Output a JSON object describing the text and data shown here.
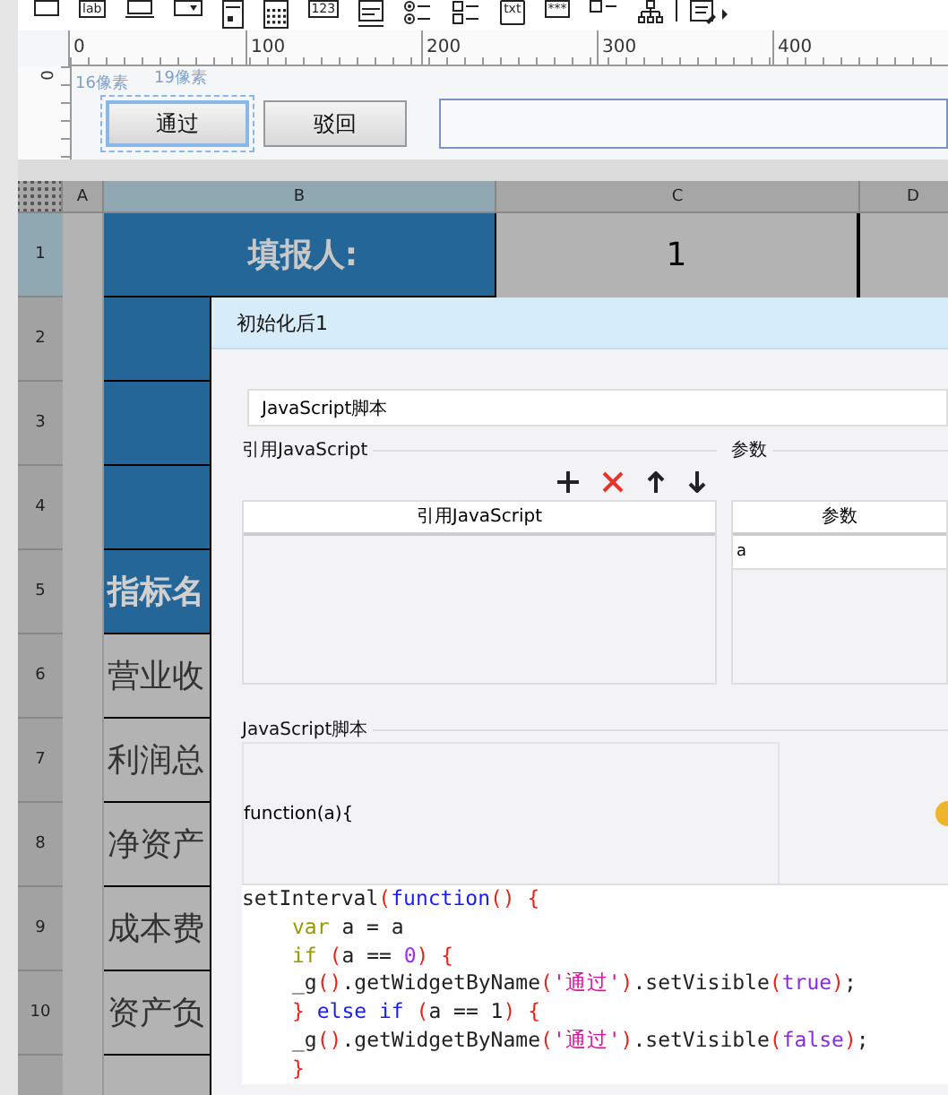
{
  "toolbar": [
    {
      "kind": "box"
    },
    {
      "kind": "label",
      "text": "lab"
    },
    {
      "kind": "input"
    },
    {
      "kind": "combo"
    },
    {
      "kind": "form"
    },
    {
      "kind": "calendar"
    },
    {
      "kind": "number",
      "text": "123"
    },
    {
      "kind": "textarea"
    },
    {
      "kind": "radio"
    },
    {
      "kind": "checkbox"
    },
    {
      "kind": "text",
      "text": "txt"
    },
    {
      "kind": "password",
      "text": "***"
    },
    {
      "kind": "check"
    },
    {
      "kind": "tree"
    },
    {
      "kind": "list"
    }
  ],
  "ruler": {
    "ticks": [
      "0",
      "100",
      "200",
      "300",
      "400"
    ],
    "vertical_tick": "0"
  },
  "canvas": {
    "top_hint": "19像素",
    "left_hint": "16像素",
    "buttons": [
      {
        "label": "通过",
        "selected": true
      },
      {
        "label": "驳回",
        "selected": false
      }
    ]
  },
  "sheet": {
    "columns": [
      {
        "label": "A",
        "selected": false
      },
      {
        "label": "B",
        "selected": true
      },
      {
        "label": "C",
        "selected": false
      },
      {
        "label": "D",
        "selected": false
      }
    ],
    "rows": [
      {
        "number": "1",
        "selected": true,
        "b": "填报人:",
        "c": "1",
        "kind": "header"
      },
      {
        "number": "2",
        "selected": false,
        "kind": "blue"
      },
      {
        "number": "3",
        "selected": false,
        "kind": "blue"
      },
      {
        "number": "4",
        "selected": false,
        "kind": "blue"
      },
      {
        "number": "5",
        "selected": false,
        "b": "指标名",
        "kind": "title"
      },
      {
        "number": "6",
        "selected": false,
        "b": "营业收",
        "kind": "plain"
      },
      {
        "number": "7",
        "selected": false,
        "b": "利润总",
        "kind": "plain"
      },
      {
        "number": "8",
        "selected": false,
        "b": "净资产",
        "kind": "plain"
      },
      {
        "number": "9",
        "selected": false,
        "b": "成本费",
        "kind": "plain"
      },
      {
        "number": "10",
        "selected": false,
        "b": "资产负",
        "kind": "plain"
      },
      {
        "selected": false,
        "kind": "plain"
      }
    ]
  },
  "dialog": {
    "title": "初始化后1",
    "type_field": "JavaScript脚本",
    "ref_group": "引用JavaScript",
    "param_group": "参数",
    "ref_table_header": "引用JavaScript",
    "param_table_header": "参数",
    "params": [
      "a"
    ],
    "script_group": "JavaScript脚本",
    "signature": "function(a){",
    "code": [
      {
        "kind": "top",
        "tokens": [
          {
            "kind": "plain",
            "text": "setInterval"
          },
          {
            "kind": "bracket",
            "text": "("
          },
          {
            "kind": "keyword2",
            "text": "function"
          },
          {
            "kind": "bracket",
            "text": "()"
          },
          {
            "kind": "bracket",
            "text": " {"
          }
        ]
      },
      {
        "kind": "body",
        "tokens": [
          {
            "kind": "keyword",
            "text": "var"
          },
          {
            "kind": "plain",
            "text": " a = a"
          }
        ]
      },
      {
        "kind": "body",
        "tokens": [
          {
            "kind": "keyword",
            "text": "if"
          },
          {
            "kind": "bracket",
            "text": " ("
          },
          {
            "kind": "plain",
            "text": "a == "
          },
          {
            "kind": "number",
            "text": "0"
          },
          {
            "kind": "bracket",
            "text": ")"
          },
          {
            "kind": "bracket",
            "text": " {"
          }
        ]
      },
      {
        "kind": "body",
        "tokens": [
          {
            "kind": "plain",
            "text": "_g"
          },
          {
            "kind": "bracket",
            "text": "()"
          },
          {
            "kind": "plain",
            "text": ".getWidgetByName"
          },
          {
            "kind": "bracket",
            "text": "("
          },
          {
            "kind": "string",
            "text": "'通过'"
          },
          {
            "kind": "bracket",
            "text": ")"
          },
          {
            "kind": "plain",
            "text": ".setVisible"
          },
          {
            "kind": "bracket",
            "text": "("
          },
          {
            "kind": "literal",
            "text": "true"
          },
          {
            "kind": "bracket",
            "text": ")"
          },
          {
            "kind": "plain",
            "text": ";"
          }
        ]
      },
      {
        "kind": "body",
        "tokens": [
          {
            "kind": "bracket",
            "text": "}"
          },
          {
            "kind": "keyword2",
            "text": " else if"
          },
          {
            "kind": "bracket",
            "text": " ("
          },
          {
            "kind": "plain",
            "text": "a == 1"
          },
          {
            "kind": "bracket",
            "text": ")"
          },
          {
            "kind": "bracket",
            "text": " {"
          }
        ]
      },
      {
        "kind": "body",
        "tokens": [
          {
            "kind": "plain",
            "text": "_g"
          },
          {
            "kind": "bracket",
            "text": "()"
          },
          {
            "kind": "plain",
            "text": ".getWidgetByName"
          },
          {
            "kind": "bracket",
            "text": "("
          },
          {
            "kind": "string",
            "text": "'通过'"
          },
          {
            "kind": "bracket",
            "text": ")"
          },
          {
            "kind": "plain",
            "text": ".setVisible"
          },
          {
            "kind": "bracket",
            "text": "("
          },
          {
            "kind": "literal",
            "text": "false"
          },
          {
            "kind": "bracket",
            "text": ")"
          },
          {
            "kind": "plain",
            "text": ";"
          }
        ]
      },
      {
        "kind": "body",
        "tokens": [
          {
            "kind": "bracket",
            "text": "}"
          }
        ]
      }
    ]
  }
}
